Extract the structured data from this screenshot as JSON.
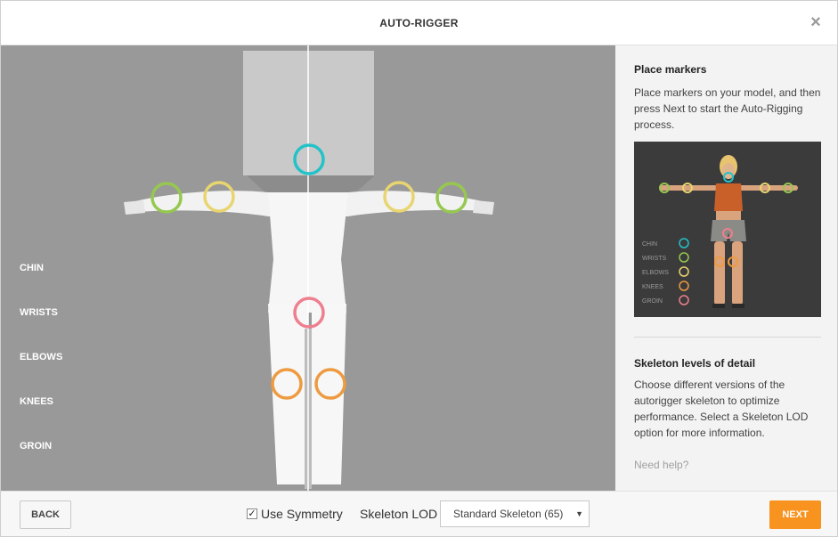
{
  "header": {
    "title": "AUTO-RIGGER",
    "close_glyph": "×"
  },
  "markers": [
    {
      "label": "CHIN",
      "color": "#22c2c9"
    },
    {
      "label": "WRISTS",
      "color": "#96c850"
    },
    {
      "label": "ELBOWS",
      "color": "#e8d570"
    },
    {
      "label": "KNEES",
      "color": "#ee9a40"
    },
    {
      "label": "GROIN",
      "color": "#ee7f8e"
    }
  ],
  "sidebar": {
    "place_title": "Place markers",
    "place_text": "Place markers on your model, and then press Next to start the Auto-Rigging process.",
    "lod_title": "Skeleton levels of detail",
    "lod_text": "Choose different versions of the autorigger skeleton to optimize performance. Select a Skeleton LOD option for more information.",
    "help": "Need help?",
    "reference_legend": [
      "CHIN",
      "WRISTS",
      "ELBOWS",
      "KNEES",
      "GROIN"
    ]
  },
  "footer": {
    "back": "BACK",
    "symmetry_label": "Use Symmetry",
    "symmetry_checked": true,
    "lod_label": "Skeleton LOD",
    "lod_selected": "Standard Skeleton (65)",
    "next": "NEXT"
  },
  "colors": {
    "accent": "#f7931e",
    "viewport_bg": "#999999"
  }
}
